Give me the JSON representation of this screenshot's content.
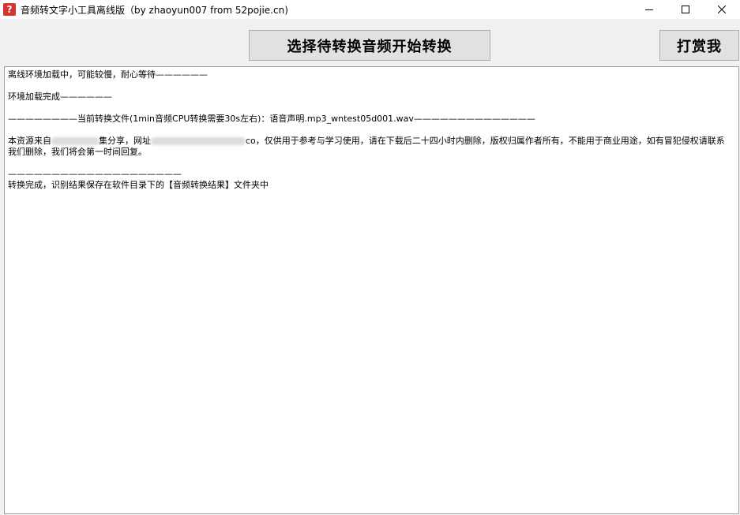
{
  "window": {
    "title": "音频转文字小工具离线版（by zhaoyun007 from 52pojie.cn)",
    "icon": "question-icon"
  },
  "toolbar": {
    "convert_label": "选择待转换音频开始转换",
    "reward_label": "打赏我"
  },
  "log": {
    "line1": "离线环境加载中，可能较慢，耐心等待——————",
    "line2": "环境加载完成——————",
    "line3": "————————当前转换文件(1min音频CPU转换需要30s左右)：语音声明.mp3_wntest05d001.wav——————————————",
    "para_a": "本资源来自",
    "para_b": "集分享，网址",
    "para_c": "co，仅供用于参考与学习使用，请在下载后二十四小时内删除，版权归属作者所有，不能用于商业用途，如有冒犯侵权请联系我们删除，我们将会第一时间回复。",
    "line5": "————————————————————",
    "line6": "转换完成，识别结果保存在软件目录下的【音频转换结果】文件夹中"
  }
}
